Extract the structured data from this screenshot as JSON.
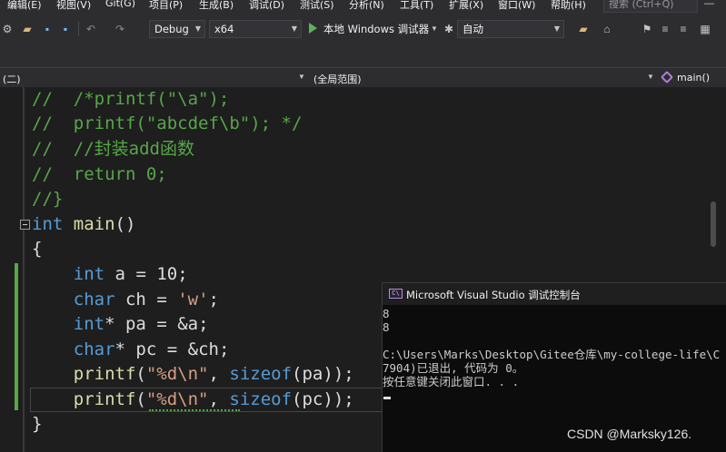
{
  "menubar": {
    "items": [
      "编辑(E)",
      "视图(V)",
      "Git(G)",
      "项目(P)",
      "生成(B)",
      "调试(D)",
      "测试(S)",
      "分析(N)",
      "工具(T)",
      "扩展(X)",
      "窗口(W)",
      "帮助(H)"
    ],
    "search_placeholder": "搜索 (Ctrl+Q)"
  },
  "toolbar": {
    "config": "Debug",
    "platform": "x64",
    "run_label": "本地 Windows 调试器",
    "run_mode": "自动"
  },
  "navbar": {
    "project": "(二)",
    "scope": "(全局范围)",
    "function": "main()"
  },
  "editor": {
    "lines": [
      "//  /*printf(\"\\a\");",
      "//  printf(\"abcdef\\b\"); */",
      "//  //封装add函数",
      "//  return 0;",
      "//}",
      "int main()",
      "{",
      "    int a = 10;",
      "    char ch = 'w';",
      "    int* pa = &a;",
      "    char* pc = &ch;",
      "    printf(\"%d\\n\", sizeof(pa));",
      "    printf(\"%d\\n\", sizeof(pc));",
      "}"
    ]
  },
  "console": {
    "title": "Microsoft Visual Studio 调试控制台",
    "lines": [
      "8",
      "8",
      "",
      "C:\\Users\\Marks\\Desktop\\Gitee仓库\\my-college-life\\C",
      "7904)已退出, 代码为 0。",
      "按任意键关闭此窗口. . ."
    ]
  },
  "watermark": "CSDN @Marksky126."
}
